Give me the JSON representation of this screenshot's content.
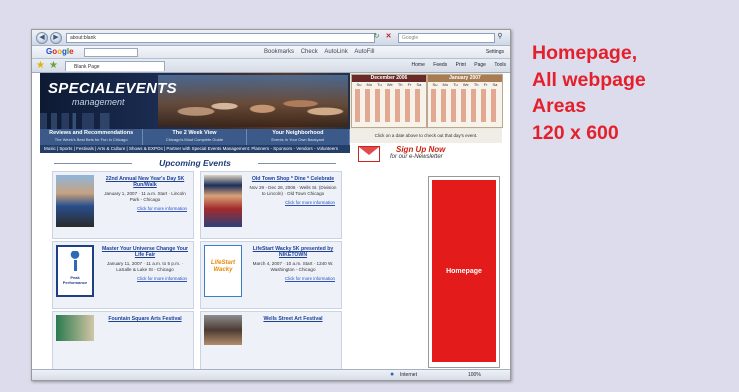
{
  "caption": {
    "line1": "Homepage,",
    "line2": "All webpage",
    "line3": "Areas",
    "line4": "120 x 600"
  },
  "browser": {
    "address": "about:blank",
    "search_placeholder": "Google",
    "google_logo": "Google",
    "gbar": [
      "Bookmarks",
      "Check",
      "AutoLink",
      "AutoFill"
    ],
    "settings": "Settings",
    "page_tab": "Blank Page",
    "cmd": [
      "Home",
      "Feeds",
      "Print",
      "Page",
      "Tools"
    ],
    "status_zone": "Internet",
    "status_zoom": "100%"
  },
  "site": {
    "logo_top": "SPECIALEVENTS",
    "logo_bottom": "management",
    "cal_left_title": "December 2006",
    "cal_right_title": "January 2007",
    "cal_days": [
      "Su",
      "Mo",
      "Tu",
      "We",
      "Th",
      "Fr",
      "Sa"
    ],
    "nav": [
      {
        "title": "Reviews and Recommendations",
        "sub": "The Week's Best Bets for Fun in Chicago"
      },
      {
        "title": "The 2 Week View",
        "sub": "Chicago's Most Complete Guide"
      },
      {
        "title": "Your Neighborhood",
        "sub": "Events In Your Own Backyard"
      }
    ],
    "categories": "Music  |  Sports  |  Festivals  |  Arts & Culture  |  Shows & EXPOs  |  Partner with Special Events Management: Planners - Sponsors - Vendors - Volunteers",
    "cal_note": "Click on a date above to check out that day's event.",
    "signup_title": "Sign Up Now",
    "signup_sub": "for our e-Newsletter",
    "upcoming": "Upcoming Events",
    "events": [
      {
        "title": "22nd Annual New Year's Day 5K Run/Walk",
        "info": "January 1, 2007 · 11 a.m. Start · Lincoln Park - Chicago",
        "link": "Click for more information"
      },
      {
        "title": "Old Town Shop * Dine * Celebrate",
        "info": "Nov 29 - Dec 28, 2006 · Wells St. (Division to Lincoln) · Old Town Chicago",
        "link": "Click for more information"
      },
      {
        "title": "Master Your Universe Change Your Life Fair",
        "info": "January 11, 2007 · 11 a.m. to 5 p.m. · LaSalle & Lake St - Chicago",
        "link": "Click for more information"
      },
      {
        "title": "LifeStart Wacky 5K presented by NIKETOWN",
        "info": "March 4, 2007 · 10 a.m. Start · 1340 W. Washington - Chicago",
        "link": "Click for more information"
      },
      {
        "title": "Fountain Square Arts Festival",
        "info": "",
        "link": ""
      },
      {
        "title": "Wells Street Art Festival",
        "info": "",
        "link": ""
      }
    ],
    "ad_label": "Homepage"
  },
  "colors": {
    "caption_red": "#e4202c",
    "ad_red": "#e31b1b",
    "background": "#dcdcec"
  }
}
